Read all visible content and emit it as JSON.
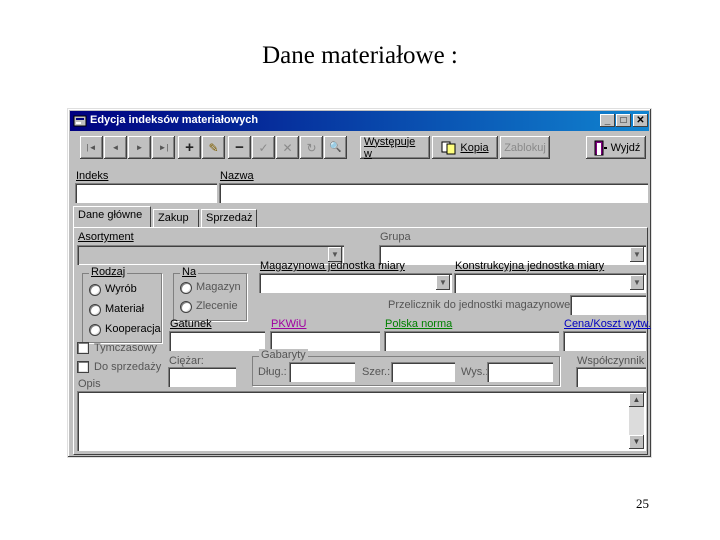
{
  "slide": {
    "title": "Dane materiałowe :",
    "page_number": "25"
  },
  "window": {
    "title": "Edycja indeksów materiałowych",
    "icon": "form-app-icon",
    "controls": {
      "minimize": "_",
      "maximize": "□",
      "close": "✕"
    }
  },
  "toolbar": {
    "first_icon": "|◄",
    "prev_icon": "◄",
    "next_icon": "►",
    "last_icon": "►|",
    "add_icon": "+",
    "edit_icon": "✎",
    "delete_icon": "−",
    "accept_icon": "✓",
    "cancel_icon": "✕",
    "refresh_icon": "↻",
    "find_icon": "🔍",
    "wystepuje_label": "Występuje w",
    "kopia_label": "Kopia",
    "zablokuj_label": "Zablokuj",
    "wyjdz_label": "Wyjdź"
  },
  "header": {
    "indeks_label": "Indeks",
    "nazwa_label": "Nazwa"
  },
  "tabs": [
    {
      "label": "Dane główne"
    },
    {
      "label": "Zakup"
    },
    {
      "label": "Sprzedaż"
    }
  ],
  "main": {
    "asortyment_label": "Asortyment",
    "grupa_label": "Grupa",
    "rodzaj": {
      "title": "Rodzaj",
      "options": [
        "Wyrób",
        "Materiał",
        "Kooperacja"
      ]
    },
    "na": {
      "title": "Na",
      "options": [
        "Magazyn",
        "Zlecenie"
      ]
    },
    "mag_jm_label": "Magazynowa jednostka miary",
    "konstr_jm_label": "Konstrukcyjna jednostka miary",
    "przelicznik_label": "Przelicznik do jednostki magazynowej:",
    "gatunek_label": "Gatunek",
    "pkwiu_label": "PKWiU",
    "polska_norma_label": "Polska norma",
    "cena_label": "Cena/Koszt wytw.",
    "tymczasowy_label": "Tymczasowy",
    "do_sprzedazy_label": "Do sprzedaży",
    "ciezar_label": "Ciężar:",
    "gabaryty": {
      "title": "Gabaryty",
      "dlug_label": "Dług.:",
      "szer_label": "Szer.:",
      "wys_label": "Wys.:"
    },
    "wspolczynnik_label": "Współczynnik",
    "opis_label": "Opis"
  },
  "colors": {
    "pkwiu": "#a000a0",
    "polska_norma": "#008000",
    "cena": "#0000c0",
    "title_start": "#000080",
    "title_end": "#1084d0"
  }
}
